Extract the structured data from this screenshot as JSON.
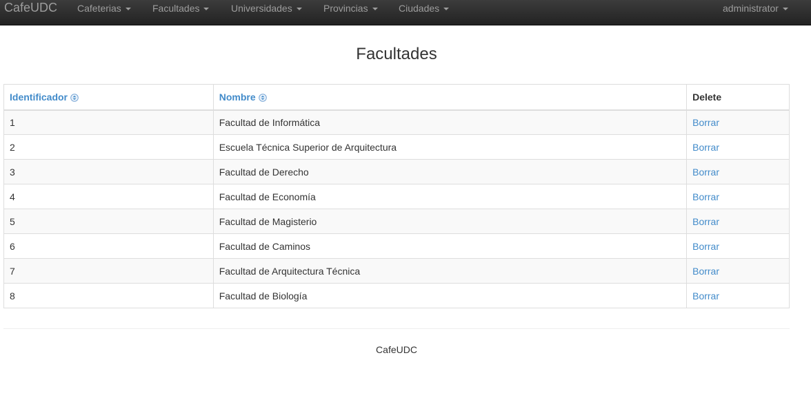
{
  "navbar": {
    "brand": "CafeUDC",
    "menus": [
      {
        "label": "Cafeterias"
      },
      {
        "label": "Facultades"
      },
      {
        "label": "Universidades"
      },
      {
        "label": "Provincias"
      },
      {
        "label": "Ciudades"
      }
    ],
    "user": "administrator"
  },
  "page": {
    "title": "Facultades"
  },
  "table": {
    "headers": {
      "id": "Identificador",
      "name": "Nombre",
      "delete": "Delete"
    },
    "rows": [
      {
        "id": "1",
        "name": "Facultad de Informática",
        "action": "Borrar"
      },
      {
        "id": "2",
        "name": "Escuela Técnica Superior de Arquitectura",
        "action": "Borrar"
      },
      {
        "id": "3",
        "name": "Facultad de Derecho",
        "action": "Borrar"
      },
      {
        "id": "4",
        "name": "Facultad de Economía",
        "action": "Borrar"
      },
      {
        "id": "5",
        "name": "Facultad de Magisterio",
        "action": "Borrar"
      },
      {
        "id": "6",
        "name": "Facultad de Caminos",
        "action": "Borrar"
      },
      {
        "id": "7",
        "name": "Facultad de Arquitectura Técnica",
        "action": "Borrar"
      },
      {
        "id": "8",
        "name": "Facultad de Biología",
        "action": "Borrar"
      }
    ]
  },
  "footer": {
    "text": "CafeUDC"
  },
  "colors": {
    "navbar_bg": "#222222",
    "nav_text": "#9d9d9d",
    "link": "#428bca",
    "striped_row": "#f9f9f9",
    "border": "#dddddd"
  },
  "icons": {
    "sort": "sort-toggle-icon",
    "dropdown": "caret-down-icon"
  }
}
